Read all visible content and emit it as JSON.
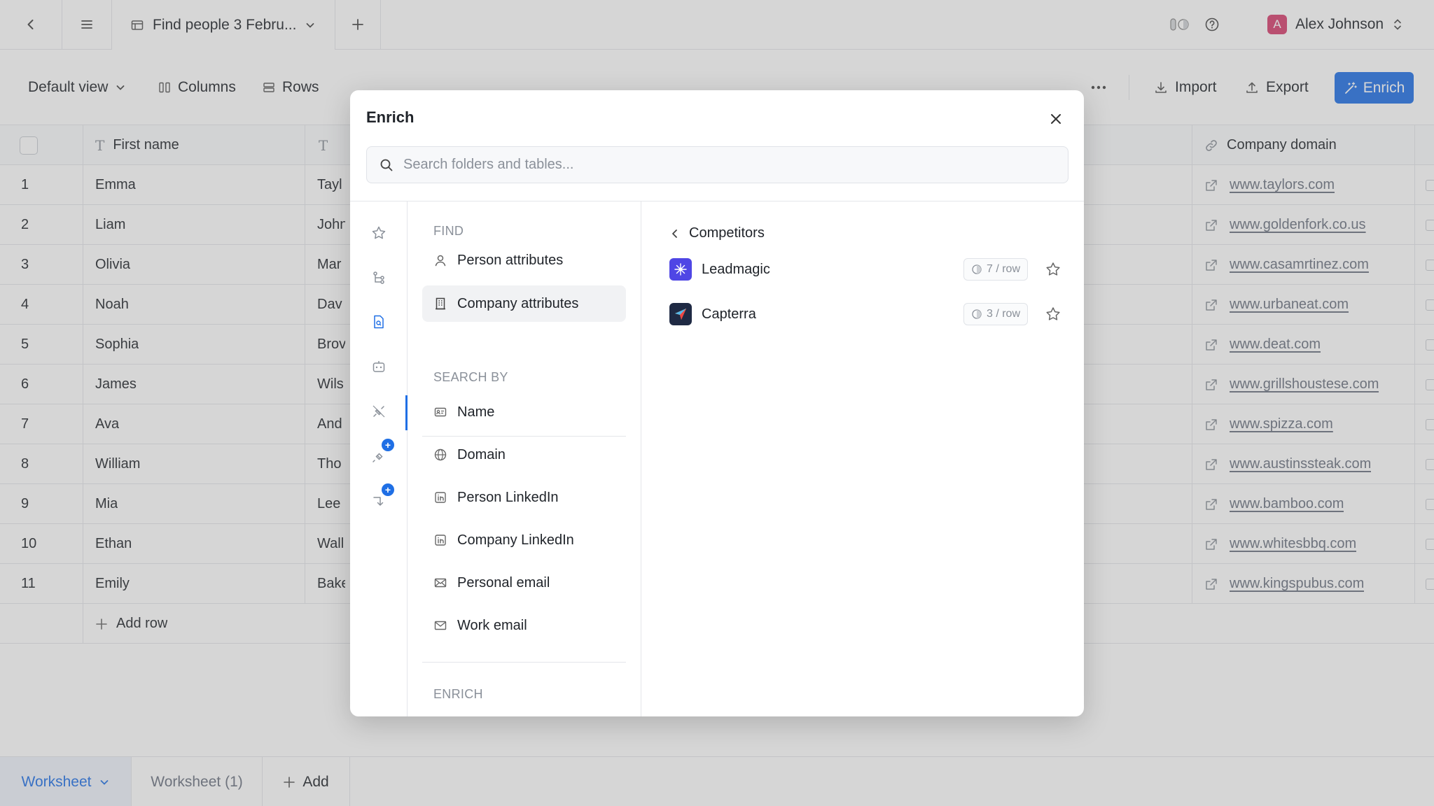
{
  "topbar": {
    "doc_title": "Find people 3 Febru...",
    "user_name": "Alex Johnson",
    "user_initial": "A"
  },
  "toolbar": {
    "view_label": "Default view",
    "columns_label": "Columns",
    "rows_label": "Rows",
    "import_label": "Import",
    "export_label": "Export",
    "enrich_label": "Enrich"
  },
  "table": {
    "col_first_name": "First name",
    "col_company_domain": "Company domain",
    "rows": [
      {
        "n": "1",
        "first": "Emma",
        "last": "Tayl",
        "domain": "www.taylors.com"
      },
      {
        "n": "2",
        "first": "Liam",
        "last": "John",
        "domain": "www.goldenfork.co.us"
      },
      {
        "n": "3",
        "first": "Olivia",
        "last": "Mar",
        "domain": "www.casamrtinez.com"
      },
      {
        "n": "4",
        "first": "Noah",
        "last": "Dav",
        "domain": "www.urbaneat.com"
      },
      {
        "n": "5",
        "first": "Sophia",
        "last": "Brov",
        "domain": "www.deat.com"
      },
      {
        "n": "6",
        "first": "James",
        "last": "Wils",
        "domain": "www.grillshoustese.com"
      },
      {
        "n": "7",
        "first": "Ava",
        "last": "And",
        "domain": "www.spizza.com"
      },
      {
        "n": "8",
        "first": "William",
        "last": "Tho",
        "domain": "www.austinssteak.com"
      },
      {
        "n": "9",
        "first": "Mia",
        "last": "Lee",
        "domain": "www.bamboo.com"
      },
      {
        "n": "10",
        "first": "Ethan",
        "last": "Wall",
        "domain": "www.whitesbbq.com"
      },
      {
        "n": "11",
        "first": "Emily",
        "last": "Bake",
        "domain": "www.kingspubus.com"
      }
    ],
    "add_row_label": "Add row"
  },
  "bottom_tabs": {
    "worksheet": "Worksheet",
    "worksheet_1": "Worksheet (1)",
    "add": "Add"
  },
  "modal": {
    "title": "Enrich",
    "search_placeholder": "Search folders and tables...",
    "find_heading": "FIND",
    "find_items": [
      "Person attributes",
      "Company attributes"
    ],
    "search_heading": "SEARCH BY",
    "search_items": [
      "Name",
      "Domain",
      "Person LinkedIn",
      "Company LinkedIn",
      "Personal email",
      "Work email"
    ],
    "enrich_heading": "ENRICH",
    "breadcrumb": "Competitors",
    "providers": [
      {
        "name": "Leadmagic",
        "cost": "7 / row"
      },
      {
        "name": "Capterra",
        "cost": "3 / row"
      }
    ]
  },
  "colors": {
    "accent": "#1f6fe5",
    "avatar": "#d63e6d"
  }
}
